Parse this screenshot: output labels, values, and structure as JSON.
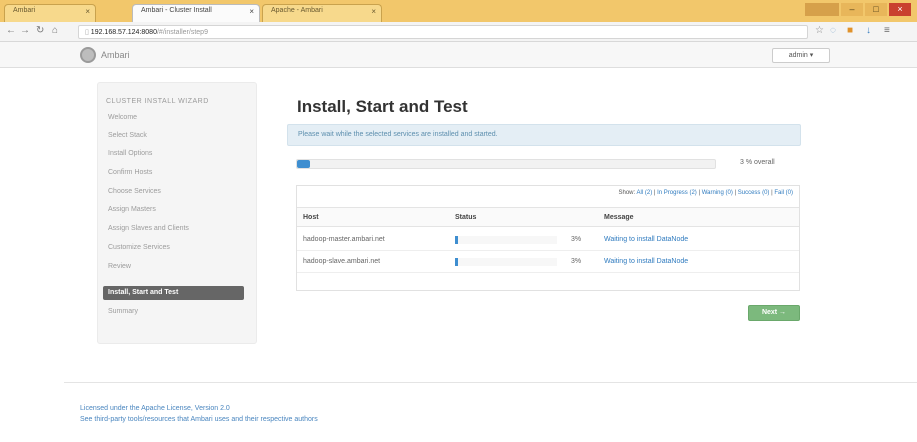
{
  "browser": {
    "tabs": [
      {
        "label": "Ambari"
      },
      {
        "label": "Ambari - Cluster Install"
      },
      {
        "label": "Apache - Ambari"
      }
    ],
    "url_host": "192.168.57.124:8080",
    "url_path": "/#/installer/step9"
  },
  "app": {
    "name": "Ambari",
    "user_menu": "admin ▾"
  },
  "sidebar": {
    "title": "CLUSTER INSTALL WIZARD",
    "items": [
      {
        "label": "Welcome"
      },
      {
        "label": "Select Stack"
      },
      {
        "label": "Install Options"
      },
      {
        "label": "Confirm Hosts"
      },
      {
        "label": "Choose Services"
      },
      {
        "label": "Assign Masters"
      },
      {
        "label": "Assign Slaves and Clients"
      },
      {
        "label": "Customize Services"
      },
      {
        "label": "Review"
      },
      {
        "label": "Install, Start and Test"
      },
      {
        "label": "Summary"
      }
    ],
    "active_index": 9
  },
  "main": {
    "title": "Install, Start and Test",
    "notice": "Please wait while the selected services are installed and started.",
    "overall_progress_percent": 3,
    "overall_label": "3 % overall",
    "filters": {
      "prefix": "Show:",
      "all": "All (2)",
      "in_progress": "In Progress (2)",
      "warning": "Warning (0)",
      "success": "Success (0)",
      "fail": "Fail (0)"
    },
    "table": {
      "headers": [
        "Host",
        "Status",
        "Message"
      ],
      "rows": [
        {
          "host": "hadoop-master.ambari.net",
          "progress_percent": 3,
          "percent_label": "3%",
          "message": "Waiting to install DataNode"
        },
        {
          "host": "hadoop-slave.ambari.net",
          "progress_percent": 3,
          "percent_label": "3%",
          "message": "Waiting to install DataNode"
        }
      ]
    },
    "next_label": "Next →"
  },
  "footer": {
    "license": "Licensed under the Apache License, Version 2.0",
    "third_party": "See third-party tools/resources that Ambari uses and their respective authors"
  },
  "colors": {
    "progress": "#3e8ed0",
    "next_button": "#7cb97d",
    "notice_bg": "#e4eef5",
    "link": "#2f7bbf"
  }
}
